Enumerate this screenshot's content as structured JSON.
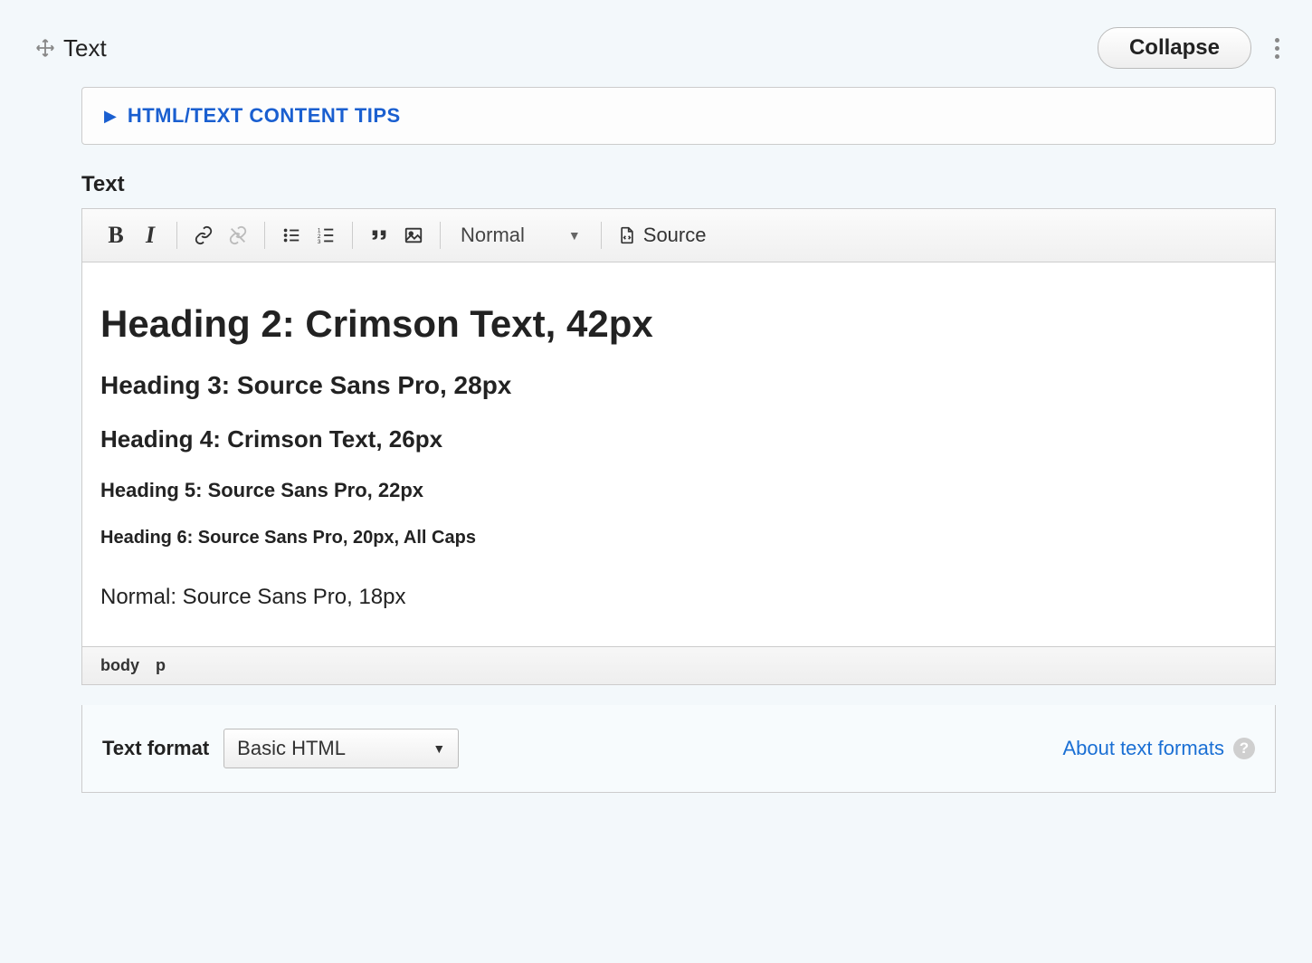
{
  "panel": {
    "title": "Text",
    "collapse_label": "Collapse"
  },
  "tips": {
    "label": "HTML/TEXT CONTENT TIPS"
  },
  "field": {
    "label": "Text"
  },
  "toolbar": {
    "format_selected": "Normal",
    "source_label": "Source"
  },
  "content": {
    "h2": "Heading 2: Crimson Text, 42px",
    "h3": "Heading 3: Source Sans Pro, 28px",
    "h4": "Heading 4: Crimson Text, 26px",
    "h5": "Heading 5: Source Sans Pro, 22px",
    "h6": "Heading 6: Source Sans Pro, 20px, All Caps",
    "normal": "Normal: Source Sans Pro, 18px"
  },
  "path": {
    "item0": "body",
    "item1": "p"
  },
  "format": {
    "label": "Text format",
    "selected": "Basic HTML",
    "about_label": "About text formats"
  }
}
